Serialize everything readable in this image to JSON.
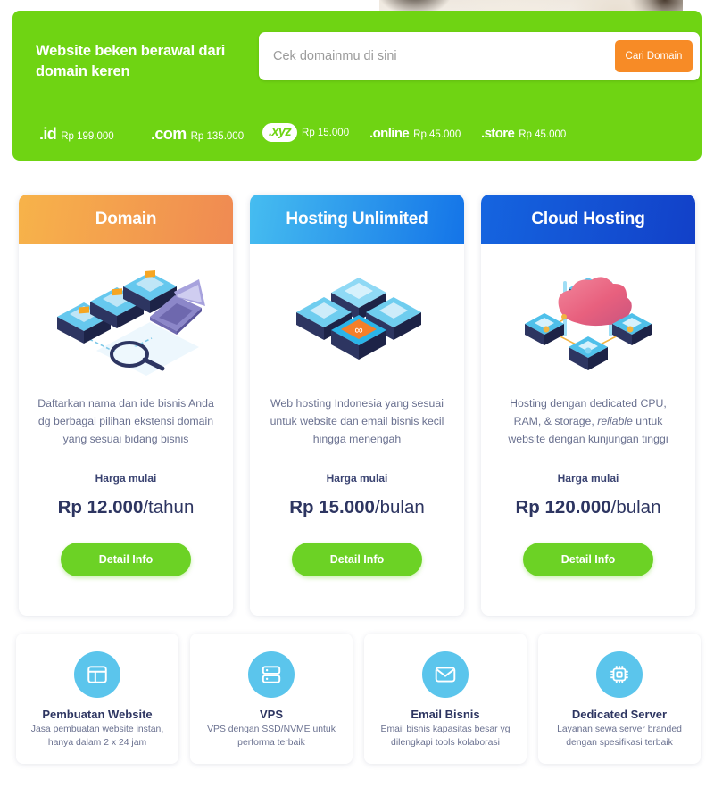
{
  "hero": {
    "title": "Website beken berawal dari domain keren",
    "search_placeholder": "Cek domainmu di sini",
    "search_value": "",
    "search_button": "Cari Domain",
    "accent_green": "#6fd413",
    "accent_orange": "#f78b26",
    "tlds": [
      {
        "name": ".id",
        "price": "Rp 199.000"
      },
      {
        "name": ".com",
        "price": "Rp 135.000"
      },
      {
        "name": ".xyz",
        "price": "Rp 15.000"
      },
      {
        "name": ".online",
        "price": "Rp 45.000"
      },
      {
        "name": ".store",
        "price": "Rp 45.000"
      }
    ]
  },
  "plans": [
    {
      "title": "Domain",
      "description": "Daftarkan nama dan ide bisnis Anda dg berbagai pilihan ekstensi domain yang sesuai bidang bisnis",
      "harga_label": "Harga mulai",
      "price_amount": "Rp 12.000",
      "price_period": "/tahun",
      "button": "Detail Info",
      "header_color": "#f08a52",
      "illustration": "servers-laptop-magnifier-illustration"
    },
    {
      "title": "Hosting Unlimited",
      "description": "Web hosting Indonesia yang sesuai untuk website dan email bisnis kecil hingga menengah",
      "harga_label": "Harga mulai",
      "price_amount": "Rp 15.000",
      "price_period": "/bulan",
      "button": "Detail Info",
      "header_color": "#1474e8",
      "illustration": "four-server-blocks-infinity-illustration"
    },
    {
      "title": "Cloud Hosting",
      "description_pre": "Hosting dengan dedicated CPU, RAM, & storage, ",
      "description_em": "reliable",
      "description_post": " untuk website dengan kunjungan tinggi",
      "description": "Hosting dengan dedicated CPU, RAM, & storage, reliable untuk website dengan kunjungan tinggi",
      "harga_label": "Harga mulai",
      "price_amount": "Rp 120.000",
      "price_period": "/bulan",
      "button": "Detail Info",
      "header_color": "#1240c8",
      "illustration": "cloud-network-nodes-illustration"
    }
  ],
  "features": [
    {
      "icon": "layout-icon",
      "title": "Pembuatan Website",
      "subtitle": "Jasa pembuatan website instan, hanya dalam 2 x 24 jam"
    },
    {
      "icon": "server-icon",
      "title": "VPS",
      "subtitle": "VPS dengan SSD/NVME untuk performa terbaik"
    },
    {
      "icon": "envelope-icon",
      "title": "Email Bisnis",
      "subtitle": "Email bisnis kapasitas besar yg dilengkapi tools kolaborasi"
    },
    {
      "icon": "cpu-chip-icon",
      "title": "Dedicated Server",
      "subtitle": "Layanan sewa server branded dengan spesifikasi terbaik"
    }
  ]
}
